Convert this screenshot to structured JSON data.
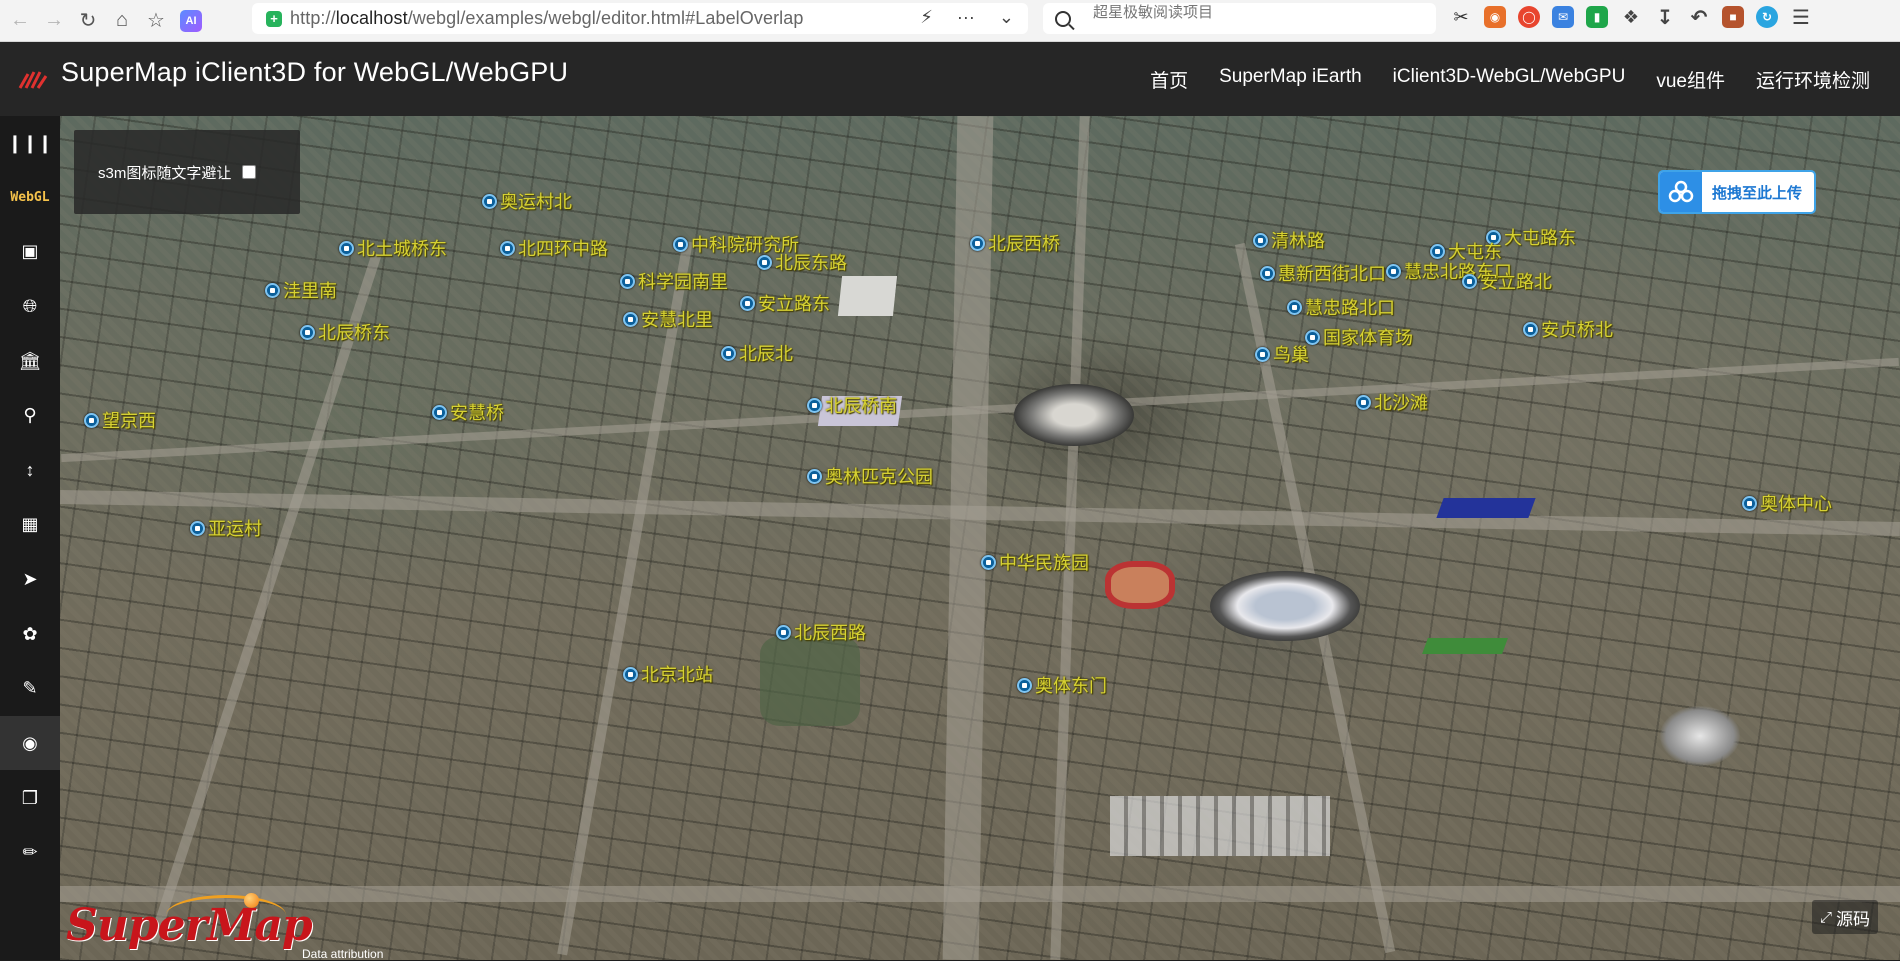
{
  "browser": {
    "url_prefix": "http://",
    "url_host": "localhost",
    "url_path": "/webgl/examples/webgl/editor.html#LabelOverlap",
    "search_placeholder": "超星极敏阅读项目",
    "ai_badge": "AI"
  },
  "header": {
    "title": "SuperMap iClient3D for WebGL/WebGPU",
    "nav": [
      "首页",
      "SuperMap iEarth",
      "iClient3D-WebGL/WebGPU",
      "vue组件",
      "运行环境检测"
    ]
  },
  "sidebar": {
    "menu_icon": "menu-icon",
    "webgl_label": "WebGL",
    "items": [
      "layer-icon",
      "globe-icon",
      "bank-icon",
      "search-icon",
      "height-icon",
      "map-icon",
      "send-icon",
      "cluster-icon",
      "edit-icon",
      "eye-icon",
      "cube-icon",
      "pencil-icon"
    ],
    "active_item": "eye-icon"
  },
  "panel": {
    "checkbox_label": "s3m图标随文字避让",
    "checked": false
  },
  "upload": {
    "label": "拖拽至此上传"
  },
  "source_button": {
    "label": "源码"
  },
  "brand": {
    "logo_text": "SuperMap",
    "attribution": "Data attribution"
  },
  "pois": [
    "奥运村北",
    "北土城桥东",
    "北四环中路",
    "洼里南",
    "清林路",
    "中科院研究所",
    "北辰西桥",
    "北辰东路",
    "科学园南里",
    "安慧北里",
    "安立路东",
    "北辰北",
    "鸟巢",
    "大屯路东",
    "大屯东",
    "惠新西街北口",
    "慧忠北路东口",
    "安立路北",
    "慧忠路北口",
    "国家体育场",
    "安贞桥北",
    "北辰桥东",
    "望京西",
    "安慧桥",
    "北辰桥南",
    "奥林匹克公园",
    "北沙滩",
    "中华民族园",
    "亚运村",
    "奥体东门",
    "北辰西路",
    "北京北站",
    "奥体中心"
  ],
  "colors": {
    "poi_label": "#d7d232",
    "poi_pin": "#0b5f9a",
    "header_bg": "#262626",
    "sidebar_bg": "#1a1a1a",
    "brand_red": "#c8151b",
    "upload_blue": "#2d8fe6"
  }
}
